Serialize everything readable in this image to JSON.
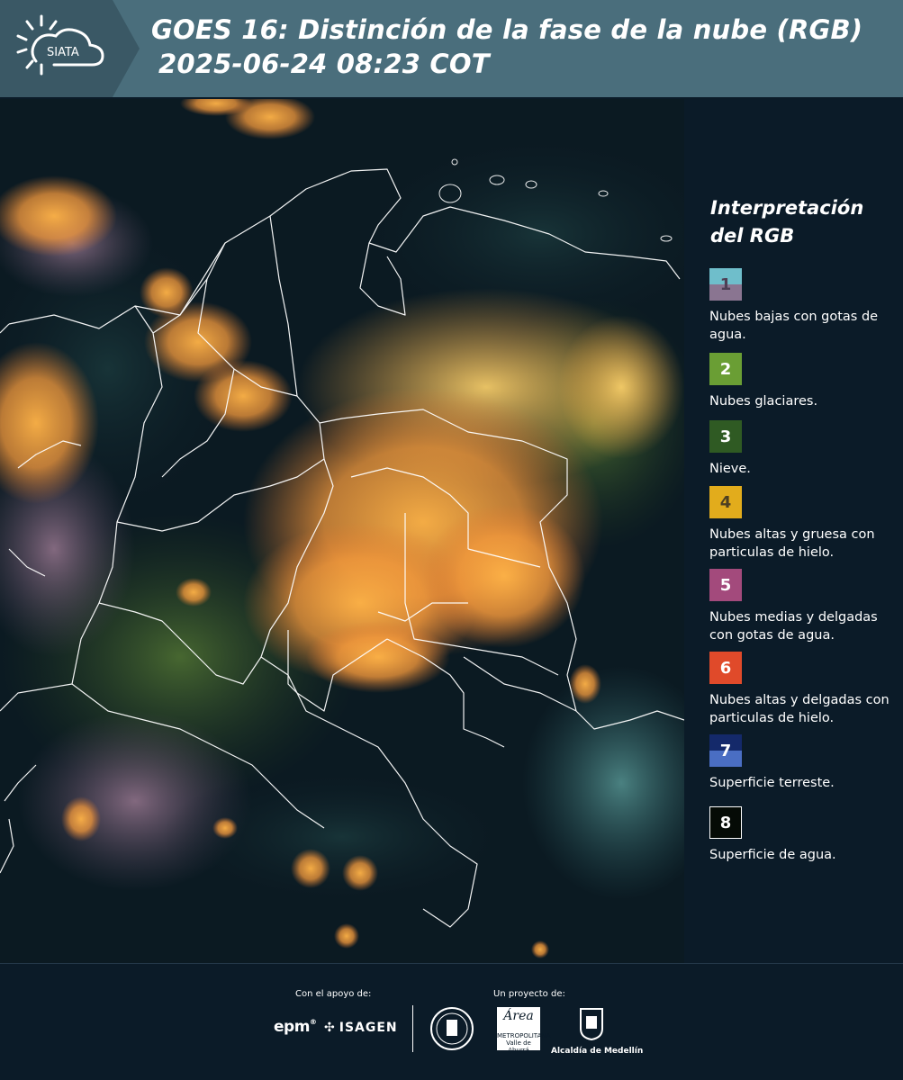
{
  "header": {
    "logo_text": "SIATA",
    "title_line1": "GOES 16: Distinción de la fase de la nube (RGB)",
    "title_line2": "2025-06-24 08:23 COT"
  },
  "legend": {
    "title": "Interpretación del RGB",
    "items": [
      {
        "number": "1",
        "label": "Nubes bajas con gotas de agua.",
        "color_top": "#6fbecb",
        "color_bottom": "#8a7591",
        "text_color": "#4d3f55"
      },
      {
        "number": "2",
        "label": "Nubes glaciares.",
        "color_top": "#6a9e34",
        "color_bottom": "#6a9e34",
        "text_color": "#ffffff"
      },
      {
        "number": "3",
        "label": "Nieve.",
        "color_top": "#2f5a23",
        "color_bottom": "#2f5a23",
        "text_color": "#ffffff"
      },
      {
        "number": "4",
        "label": "Nubes altas y gruesa con particulas de hielo.",
        "color_top": "#e2ac1c",
        "color_bottom": "#e2ac1c",
        "text_color": "#4d3f22"
      },
      {
        "number": "5",
        "label": "Nubes medias y delgadas con gotas de agua.",
        "color_top": "#a34a7c",
        "color_bottom": "#a34a7c",
        "text_color": "#ffffff"
      },
      {
        "number": "6",
        "label": "Nubes altas y delgadas con particulas de hielo.",
        "color_top": "#e04a2a",
        "color_bottom": "#e04a2a",
        "text_color": "#ffffff"
      },
      {
        "number": "7",
        "label": "Superficie terreste.",
        "color_top": "#14296a",
        "color_bottom": "#4a6ec3",
        "text_color": "#ffffff"
      },
      {
        "number": "8",
        "label": "Superficie de agua.",
        "color_top": "#050b06",
        "color_bottom": "#050b06",
        "text_color": "#ffffff"
      }
    ]
  },
  "footer": {
    "support_label": "Con el apoyo de:",
    "project_label": "Un proyecto de:",
    "epm": "epm",
    "isagen": "ISAGEN",
    "area_label": "METROPOLITANA Valle de Aburrá",
    "area_word": "Área",
    "alcaldia": "Alcaldía de Medellín"
  }
}
